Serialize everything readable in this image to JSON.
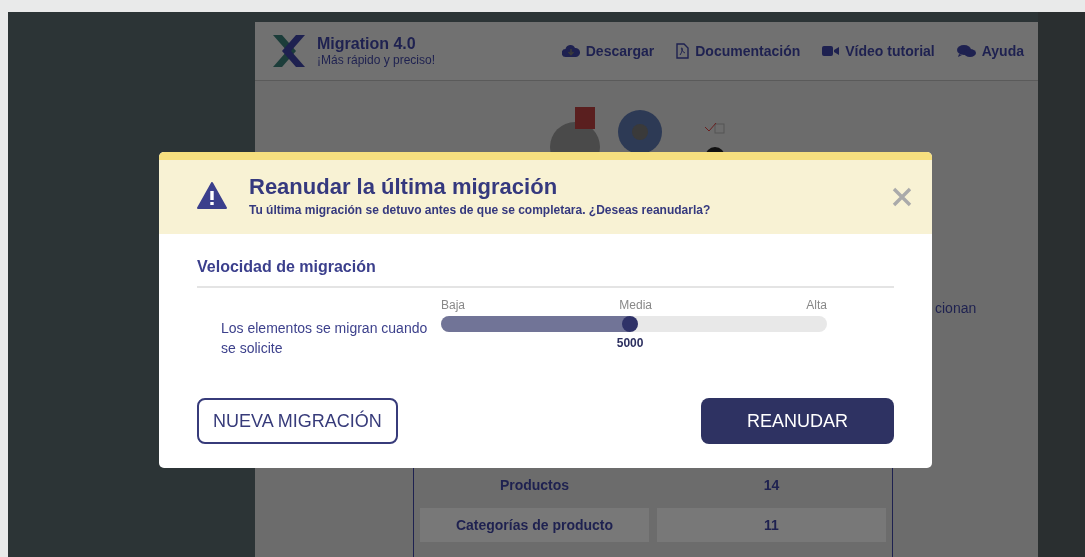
{
  "app": {
    "title": "Migration 4.0",
    "subtitle": "¡Más rápido y preciso!",
    "nav": [
      {
        "kind": "download",
        "label": "Descargar"
      },
      {
        "kind": "pdf",
        "label": "Documentación"
      },
      {
        "kind": "video",
        "label": "Vídeo tutorial"
      },
      {
        "kind": "chat",
        "label": "Ayuda"
      }
    ],
    "hidden_text": "cionan",
    "table_rows": [
      {
        "name": "Productos",
        "count": "14"
      },
      {
        "name": "Categorías de producto",
        "count": "11"
      }
    ]
  },
  "dialog": {
    "title": "Reanudar la última migración",
    "message": "Tu última migración se detuvo antes de que se completara. ¿Deseas reanudarla?",
    "section_title": "Velocidad de migración",
    "slider": {
      "description": "Los elementos se migran cuando se solicite",
      "ticks": [
        "Baja",
        "Media",
        "Alta"
      ],
      "level": 0.49,
      "value": "5000"
    },
    "buttons": [
      {
        "kind": "secondary",
        "label": "NUEVA MIGRACIÓN"
      },
      {
        "kind": "primary",
        "label": "REANUDAR"
      }
    ]
  }
}
